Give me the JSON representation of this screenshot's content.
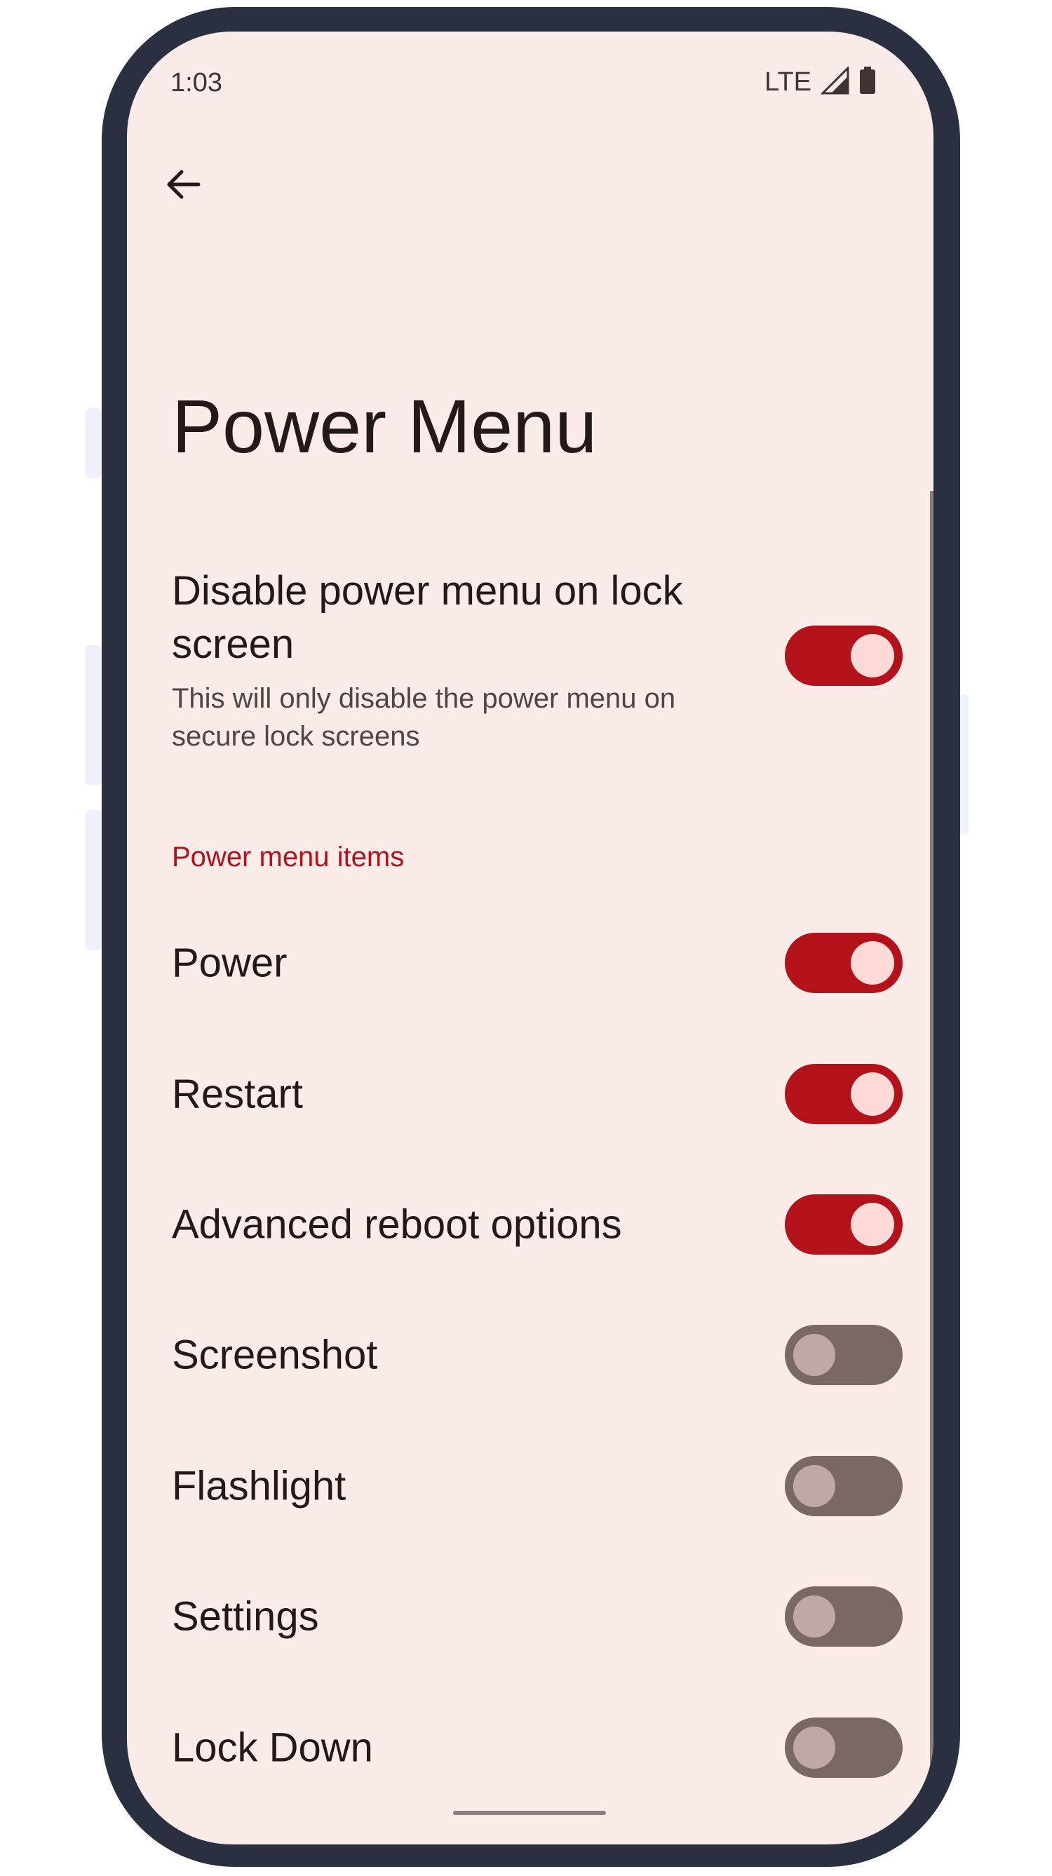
{
  "status_bar": {
    "time": "1:03",
    "network": "LTE",
    "signal_icon": "signal-icon",
    "battery_icon": "battery-icon"
  },
  "toolbar": {
    "back_icon": "arrow-back-icon"
  },
  "page_title": "Power Menu",
  "lock_screen_pref": {
    "title": "Disable power menu on lock screen",
    "summary": "This will only disable the power menu on secure lock screens",
    "enabled": true
  },
  "section_header": "Power menu items",
  "items": [
    {
      "label": "Power",
      "enabled": true
    },
    {
      "label": "Restart",
      "enabled": true
    },
    {
      "label": "Advanced reboot options",
      "enabled": true
    },
    {
      "label": "Screenshot",
      "enabled": false
    },
    {
      "label": "Flashlight",
      "enabled": false
    },
    {
      "label": "Settings",
      "enabled": false
    },
    {
      "label": "Lock Down",
      "enabled": false
    }
  ],
  "colors": {
    "accent": "#b3121b",
    "background": "#fbecea",
    "frame": "#2b3040"
  }
}
